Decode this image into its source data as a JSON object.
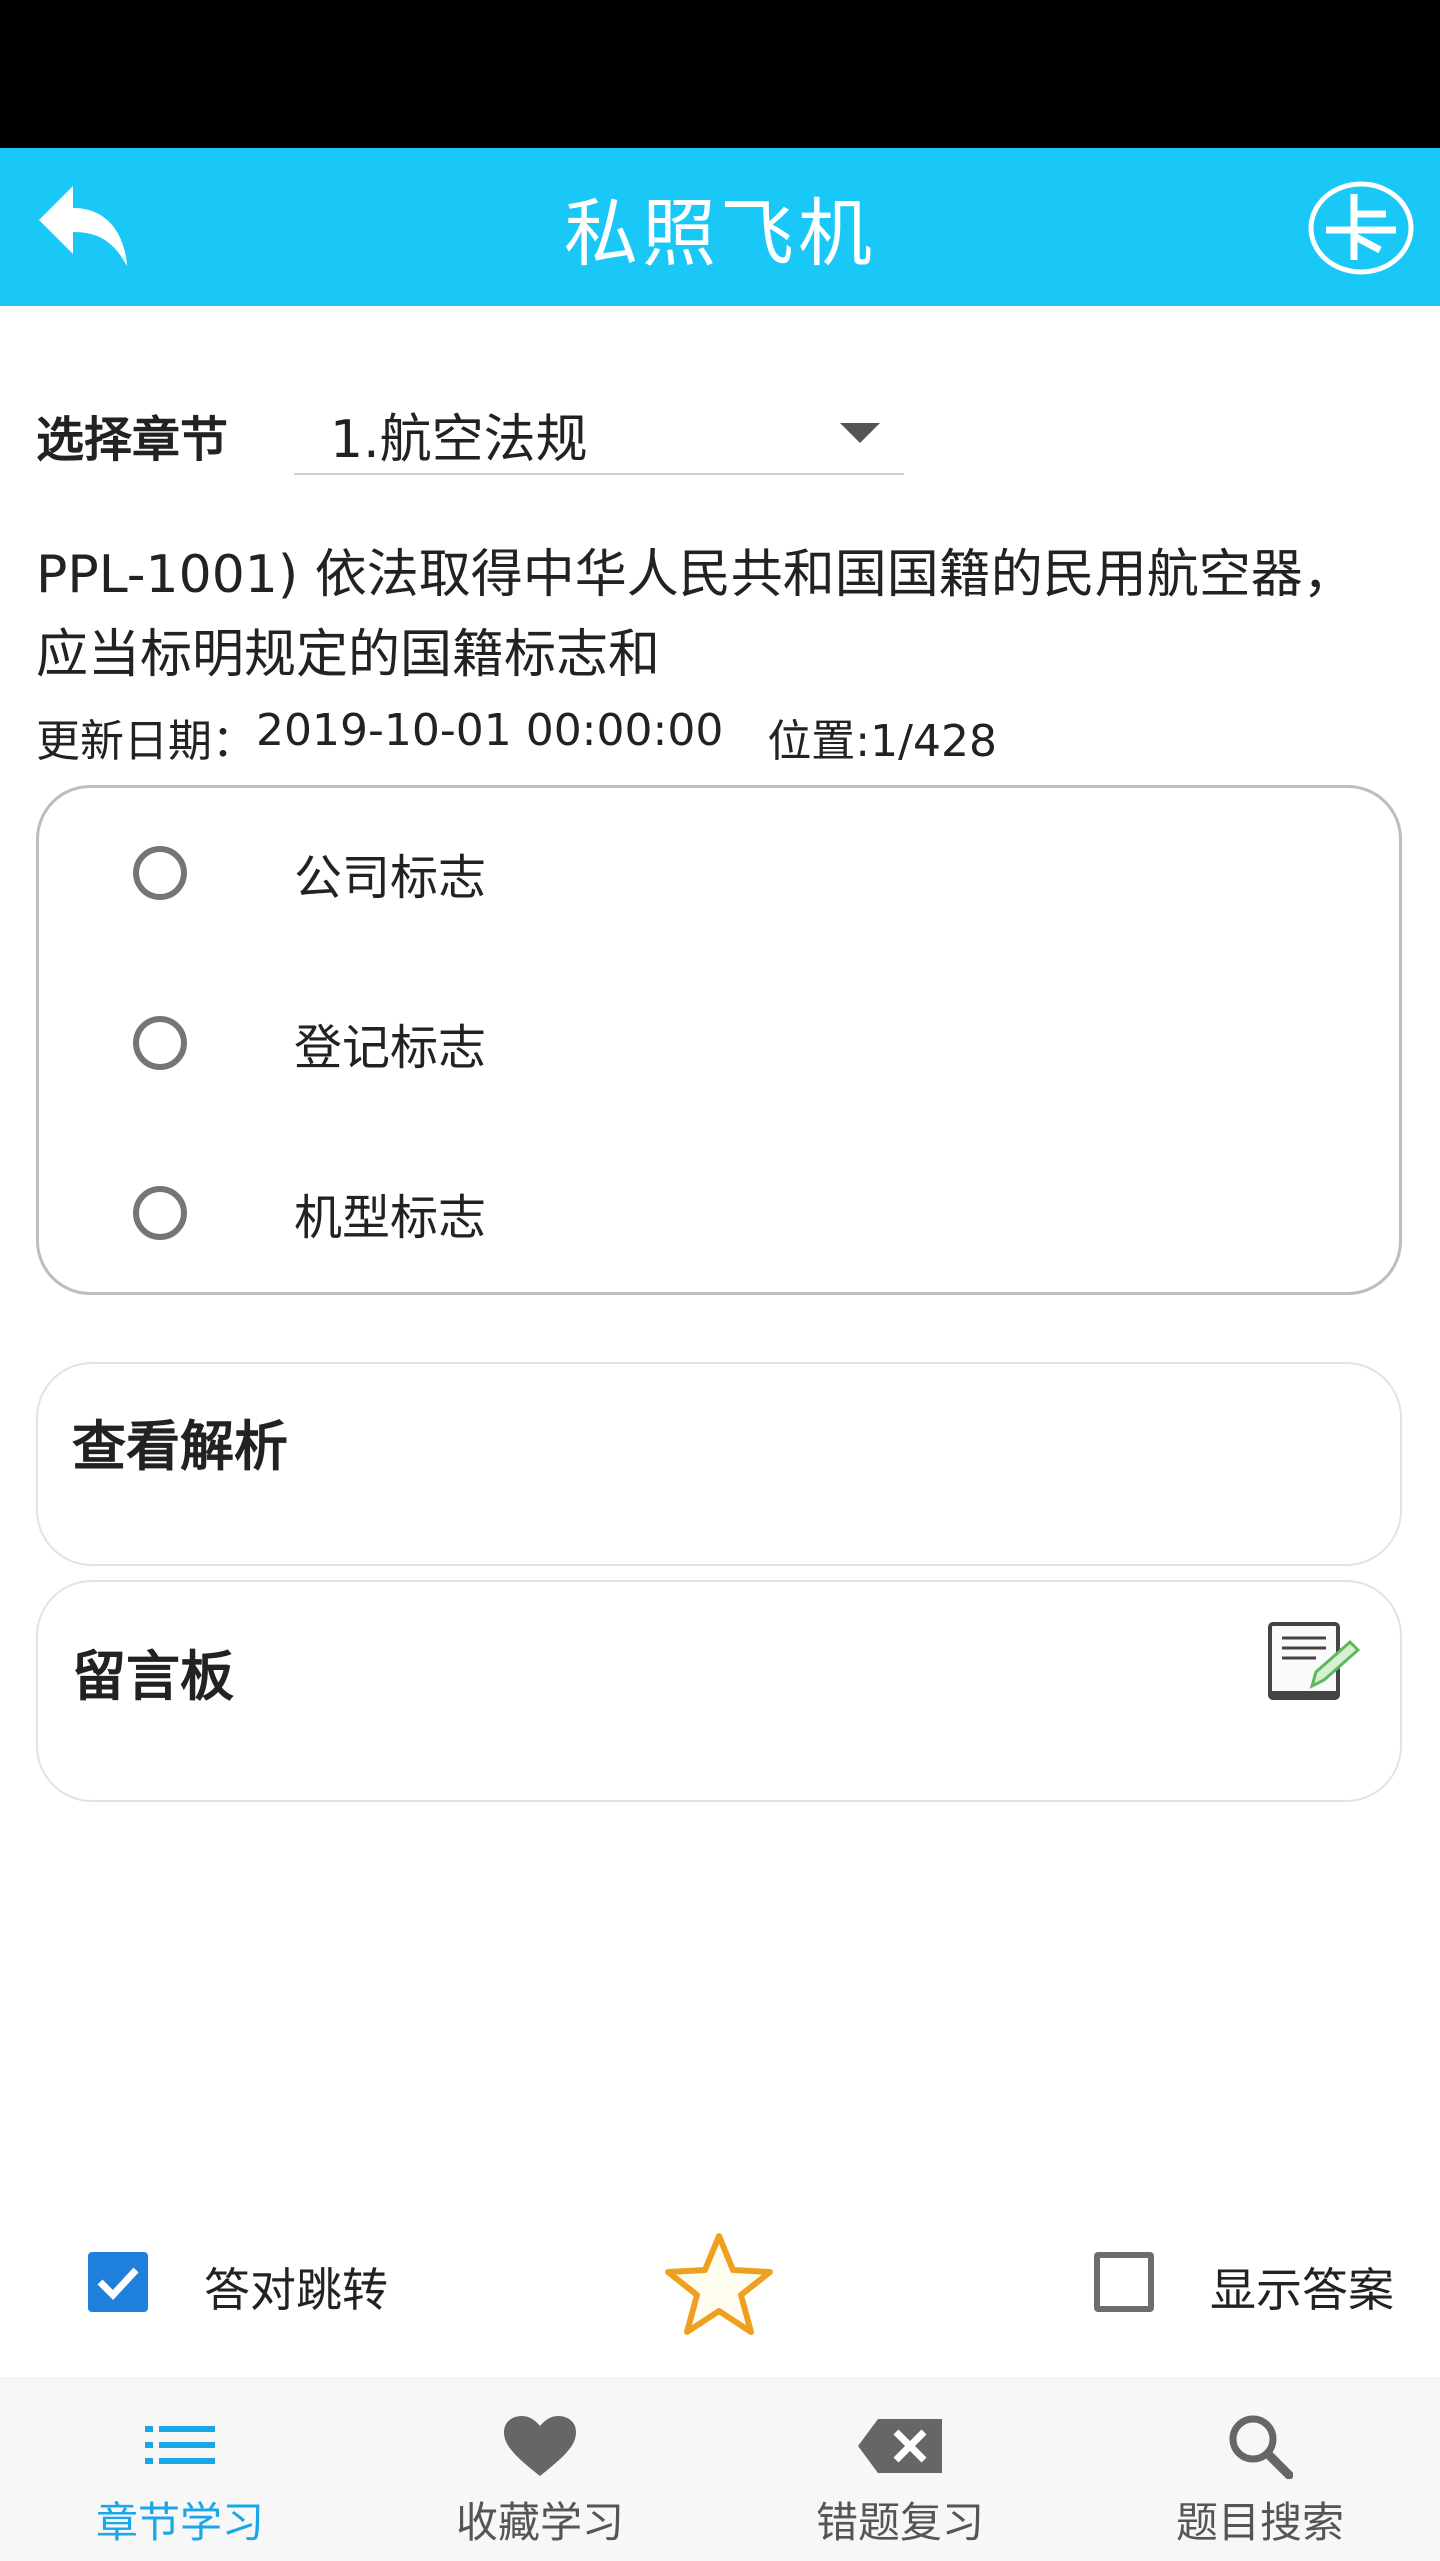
{
  "app_bar": {
    "title": "私照飞机"
  },
  "chapter": {
    "label": "选择章节",
    "selected": "1.航空法规"
  },
  "question": {
    "text": "PPL-1001) 依法取得中华人民共和国国籍的民用航空器，应当标明规定的国籍标志和",
    "update_label": "更新日期：",
    "update_date": "2019-10-01 00:00:00",
    "position": "位置:1/428"
  },
  "options": [
    {
      "label": "公司标志"
    },
    {
      "label": "登记标志"
    },
    {
      "label": "机型标志"
    }
  ],
  "analysis": {
    "title": "查看解析"
  },
  "message_board": {
    "title": "留言板"
  },
  "controls": {
    "auto_jump": "答对跳转",
    "show_answer": "显示答案"
  },
  "tabs": [
    {
      "label": "章节学习",
      "icon": "list-icon"
    },
    {
      "label": "收藏学习",
      "icon": "heart-icon"
    },
    {
      "label": "错题复习",
      "icon": "delete-icon"
    },
    {
      "label": "题目搜索",
      "icon": "search-icon"
    }
  ],
  "colors": {
    "primary": "#1ac8f8",
    "active_tab": "#1aa7e8",
    "checkbox": "#1f7fdc",
    "star": "#f0a020"
  }
}
